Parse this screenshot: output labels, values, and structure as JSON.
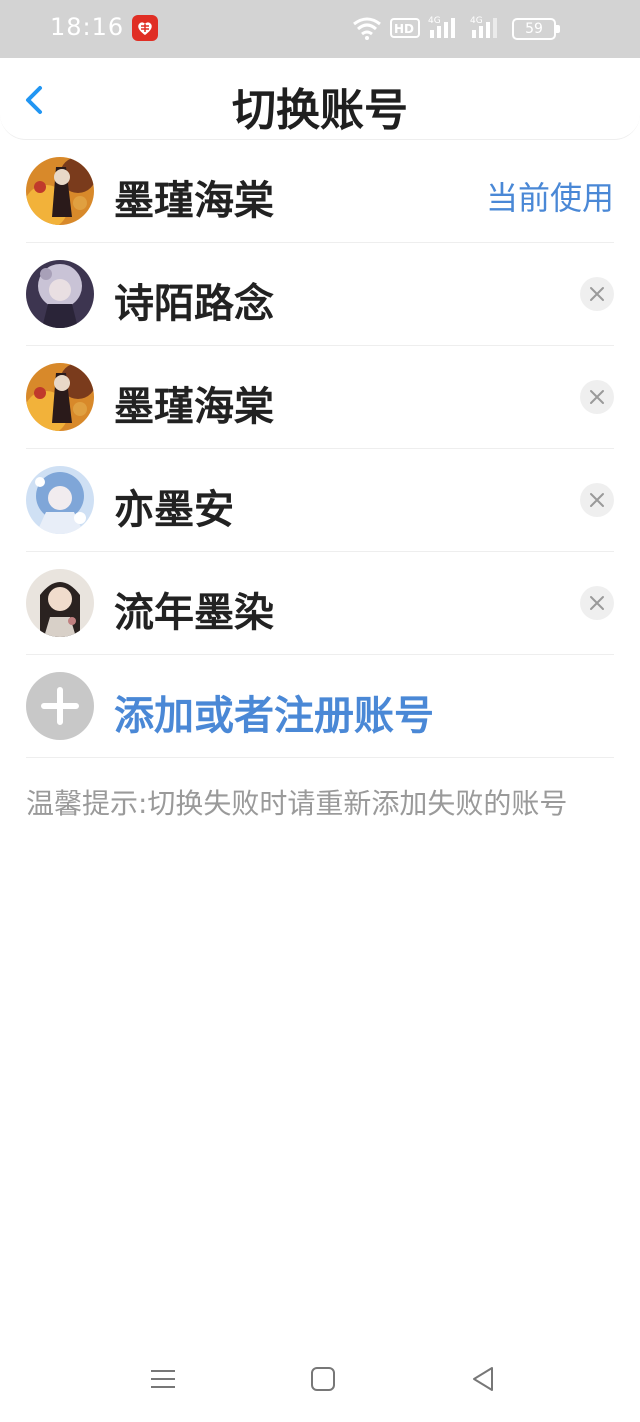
{
  "status": {
    "time": "18:16",
    "battery": "59"
  },
  "header": {
    "title": "切换账号"
  },
  "accounts": [
    {
      "name": "墨瑾海棠",
      "current_label": "当前使用"
    },
    {
      "name": "诗陌路念"
    },
    {
      "name": "墨瑾海棠"
    },
    {
      "name": "亦墨安"
    },
    {
      "name": "流年墨染"
    }
  ],
  "add_account": {
    "label": "添加或者注册账号"
  },
  "tip": {
    "text": "温馨提示:切换失败时请重新添加失败的账号"
  },
  "colors": {
    "accent": "#4a88d6",
    "status_bar": "#d3d3d3",
    "back_icon": "#2196f3"
  }
}
